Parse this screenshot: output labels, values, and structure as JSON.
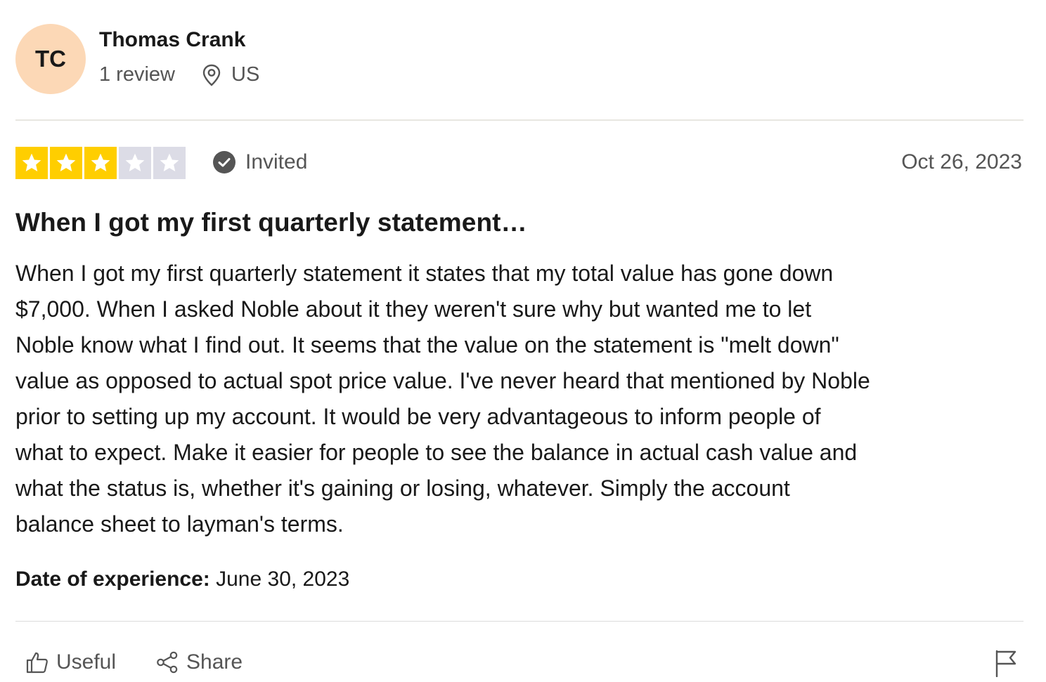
{
  "consumer": {
    "initials": "TC",
    "name": "Thomas Crank",
    "review_count": "1 review",
    "country": "US",
    "avatar_color": "#fcd8b6"
  },
  "review": {
    "rating": 3,
    "max_rating": 5,
    "star_color": "#ffce00",
    "badge_label": "Invited",
    "date": "Oct 26, 2023",
    "title": "When I got my first quarterly statement…",
    "body_lines": [
      "When I got my first quarterly statement it states that my total value has gone down",
      "$7,000. When I asked Noble about it they weren't sure why but wanted me to let",
      "Noble know what I find out. It seems that the value on the statement is \"melt down\"",
      "value as opposed to actual spot price value. I've never heard that mentioned by Noble",
      "prior to setting up my account. It would be very advantageous to inform people of",
      "what to expect. Make it easier for people to see the balance in actual cash value and",
      "what the status is, whether it's gaining or losing, whatever. Simply the account",
      "balance sheet to layman's terms."
    ],
    "experience_label": "Date of experience:",
    "experience_date": "June 30, 2023"
  },
  "actions": {
    "useful_label": "Useful",
    "share_label": "Share"
  },
  "icons": {
    "location": "location-pin-icon",
    "verified": "check-circle-icon",
    "useful": "thumbs-up-icon",
    "share": "share-icon",
    "flag": "flag-icon"
  }
}
